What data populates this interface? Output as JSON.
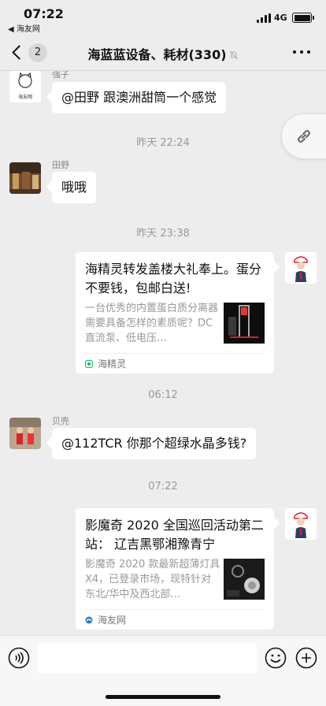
{
  "status_bar": {
    "time": "07:22",
    "back_app": "◀ 海友网",
    "network": "4G"
  },
  "nav": {
    "unread_count": "2",
    "title": "海蓝蓝设备、耗材(330)"
  },
  "messages": [
    {
      "sender": "强子",
      "avatar_text": "海友网",
      "text": "@田野  跟澳洲甜筒一个感觉"
    },
    {
      "timestamp": "昨天 22:24"
    },
    {
      "sender": "田野",
      "text": "哦哦"
    },
    {
      "timestamp": "昨天 23:38"
    },
    {
      "card_title": "海精灵转发盖楼大礼奉上。蛋分不要钱，包邮白送!",
      "card_desc": "一台优秀的内置蛋白质分离器需要具备怎样的素质呢？DC直流泵、低电压…",
      "card_source": "海精灵"
    },
    {
      "timestamp": "06:12"
    },
    {
      "sender": "贝壳",
      "text": "@112TCR 你那个超绿水晶多钱?"
    },
    {
      "timestamp": "07:22"
    },
    {
      "card_title": "影魔奇 2020 全国巡回活动第二站： 辽吉黑鄂湘豫青宁",
      "card_desc": "影魔奇 2020 款最新超薄灯具 X4，已登录市场，现特针对东北/华中及西北部…",
      "card_source": "海友网"
    }
  ],
  "input": {
    "placeholder": ""
  },
  "icons": {
    "back": "chevron-left-icon",
    "mute": "bell-slash-icon",
    "more": "more-dots-icon",
    "link": "link-icon",
    "voice": "voice-icon",
    "emoji": "emoji-icon",
    "plus": "plus-icon"
  },
  "colors": {
    "background": "#ededed",
    "bubble": "#ffffff",
    "timestamp": "#999999",
    "card_source_green": "#07c160"
  }
}
